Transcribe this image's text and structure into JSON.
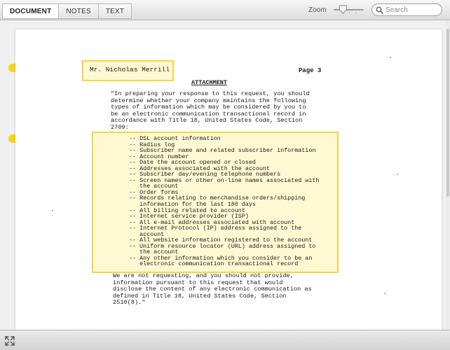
{
  "toolbar": {
    "tabs": [
      {
        "label": "DOCUMENT",
        "active": true
      },
      {
        "label": "NOTES",
        "active": false
      },
      {
        "label": "TEXT",
        "active": false
      }
    ],
    "zoom_label": "Zoom",
    "zoom_level": 0.3,
    "search_placeholder": "Search"
  },
  "document": {
    "addressee": "Mr. Nicholas Merrill",
    "page_number": "Page 3",
    "attachment_title": "ATTACHMENT",
    "intro_paragraph": "\"In preparing your response to this request, you should\ndetermine whether your company maintains the following\ntypes of information which may be considered by you to\nbe an electronic communication transactional record in\naccordance with Title 18, United States Code, Section\n2709:",
    "items": "-- DSL account information\n-- Radius log\n-- Subscriber name and related subscriber information\n-- Account number\n-- Date the account opened or closed\n-- Addresses associated with the account\n-- Subscriber day/evening telephone numbers\n-- Screen names or other on-line names associated with\n   the account\n-- Order forms\n-- Records relating to merchandise orders/shipping\n   information for the last 180 days\n-- All billing related to account\n-- Internet service provider (ISP)\n-- All e-mail addresses associated with account\n-- Internet Protocol (IP) address assigned to the\n   account\n-- All website information registered to the account\n-- Uniform resource locator (URL) address assigned to\n   the account\n-- Any other information which you consider to be an\n   electronic communication transactional record",
    "closing_paragraph": "We are not requesting, and you should not provide,\ninformation pursuant to this request that would\ndisclose the content of any electronic communication as\ndefined in Title 18, United States Code, Section\n2510(8).\""
  },
  "colors": {
    "highlight_fill": "#fff2a8",
    "highlight_border": "#f6ce28",
    "note_marker": "#f7d417"
  },
  "icons": {
    "search": "magnifier-icon",
    "expand": "expand-arrows-icon",
    "note_marker": "note-marker-icon"
  }
}
